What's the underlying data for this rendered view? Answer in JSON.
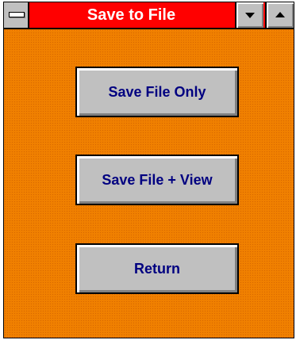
{
  "window": {
    "title": "Save to File",
    "colors": {
      "titlebar": "#ff0000",
      "background": "#f08000",
      "button_text": "#000080",
      "button_face": "#c0c0c0"
    }
  },
  "titlebar": {
    "system_menu_icon": "system-menu-icon",
    "minimize_icon": "chevron-down-icon",
    "maximize_icon": "chevron-up-icon"
  },
  "buttons": {
    "save_file_only": "Save File Only",
    "save_file_view": "Save File + View",
    "return": "Return"
  }
}
